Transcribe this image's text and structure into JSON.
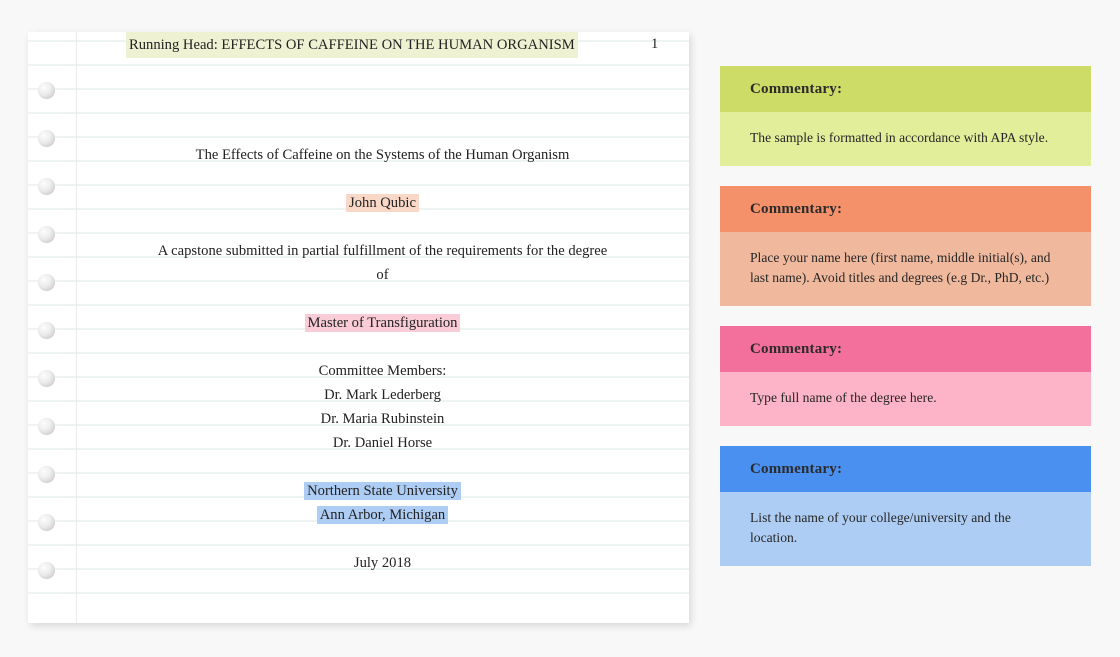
{
  "document": {
    "running_head": "Running Head: EFFECTS OF CAFFEINE ON THE HUMAN ORGANISM",
    "page_number": "1",
    "title": "The Effects of Caffeine on the Systems of the Human Organism",
    "author": "John Qubic",
    "submission_line_1": "A capstone submitted in partial fulfillment of the requirements for the degree",
    "submission_line_2": "of",
    "degree": "Master of Transfiguration",
    "committee_heading": "Committee Members:",
    "committee_member_1": "Dr. Mark Lederberg",
    "committee_member_2": "Dr. Maria Rubinstein",
    "committee_member_3": "Dr. Daniel Horse",
    "institution": "Northern State University",
    "location": "Ann Arbor, Michigan",
    "date": "July 2018"
  },
  "commentary": {
    "cards": [
      {
        "heading": "Commentary:",
        "text": "The sample is formatted in accordance with APA style.",
        "header_color": "#ccdc66",
        "body_color": "#e3ee9b"
      },
      {
        "heading": "Commentary:",
        "text": "Place your name here (first name, middle initial(s), and last name). Avoid titles and degrees (e.g Dr., PhD, etc.)",
        "header_color": "#f4916b",
        "body_color": "#f0b99d"
      },
      {
        "heading": "Commentary:",
        "text": "Type full name of the degree here.",
        "header_color": "#f4709c",
        "body_color": "#fdb3c8"
      },
      {
        "heading": "Commentary:",
        "text": "List the name of your college/university and the location.",
        "header_color": "#4a90f0",
        "body_color": "#aecdf4"
      }
    ]
  },
  "highlights": {
    "running_head_color": "#eef1d2",
    "author_color": "#f9d8c7",
    "degree_color": "#f9ccd8",
    "institution_color": "#aecdf4"
  }
}
